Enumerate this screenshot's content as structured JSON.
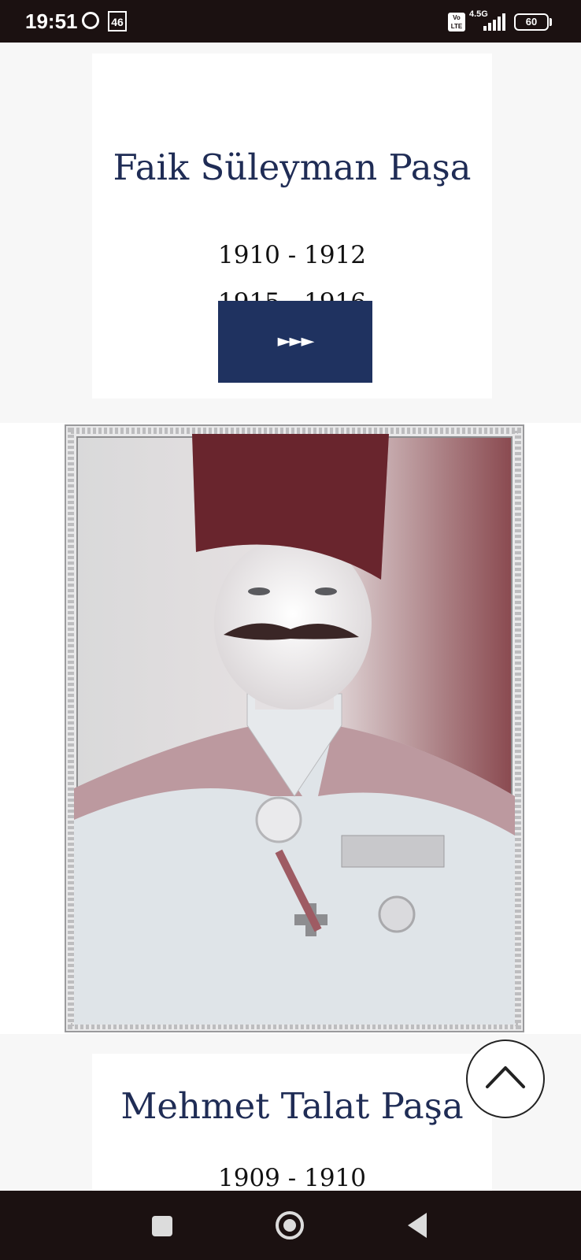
{
  "status_bar": {
    "time": "19:51",
    "network_badge": "46",
    "volte": "Vo LTE",
    "network_type": "4.5G",
    "battery": "60"
  },
  "cards": [
    {
      "name": "Faik Süleyman Paşa",
      "terms": [
        "1910 - 1912",
        "1915 - 1916"
      ],
      "button_label": "►►►"
    },
    {
      "name": "Mehmet Talat Paşa",
      "terms": [
        "1909 - 1910"
      ]
    }
  ],
  "colors": {
    "title": "#1f2c55",
    "button_bg": "#1f3260",
    "system_bars": "#1b1111"
  },
  "icons": {
    "scroll_top": "chevron-up-icon",
    "nav_recent": "square-icon",
    "nav_home": "circle-icon",
    "nav_back": "triangle-back-icon"
  }
}
